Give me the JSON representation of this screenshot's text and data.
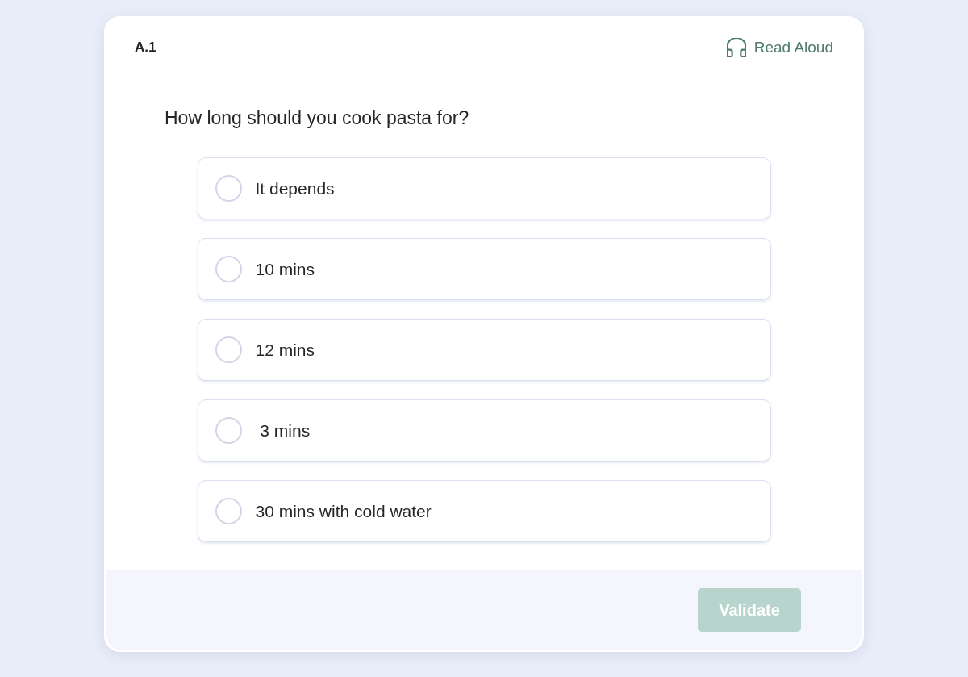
{
  "header": {
    "number": "A.1",
    "read_aloud": "Read Aloud"
  },
  "question": "How long should you cook pasta for?",
  "options": [
    {
      "label": "It depends",
      "selected": false
    },
    {
      "label": "10 mins",
      "selected": false
    },
    {
      "label": "12 mins",
      "selected": false
    },
    {
      "label": " 3 mins",
      "selected": false
    },
    {
      "label": "30 mins with cold water",
      "selected": false
    }
  ],
  "footer": {
    "button": {
      "label": "Validate",
      "disabled": true
    }
  }
}
